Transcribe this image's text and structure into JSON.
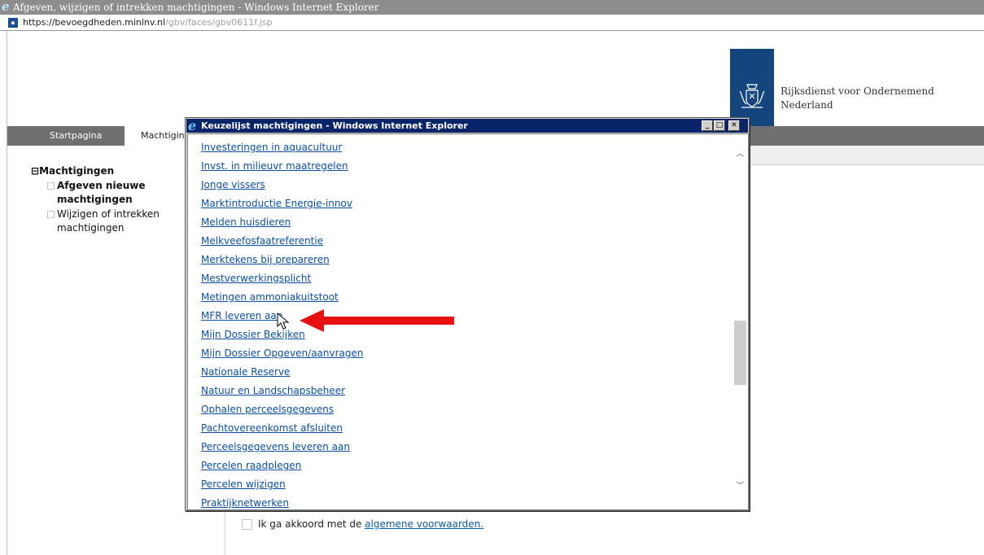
{
  "window": {
    "title": "Afgeven, wijzigen of intrekken machtigingen - Windows Internet Explorer",
    "icon": "ie-icon",
    "url_host": "https://bevoegdheden.minlnv.nl",
    "url_path": "/gbv/faces/gbv0611f.jsp"
  },
  "brand": {
    "line1": "Rijksdienst voor Ondernemend",
    "line2": "Nederland",
    "logo_color": "#15457d"
  },
  "nav": {
    "tabs": [
      "Startpagina",
      "Machtigin"
    ]
  },
  "sidebar": {
    "root": "Machtigingen",
    "root_toggle": "⊟",
    "items": [
      {
        "label": "Afgeven nieuwe machtigingen",
        "bold": true
      },
      {
        "label": "Wijzigen of intrekken machtigingen",
        "bold": false
      }
    ]
  },
  "agreement": {
    "text": "Ik ga akkoord met de ",
    "link": "algemene voorwaarden."
  },
  "popup": {
    "title": "Keuzelijst machtigingen - Windows Internet Explorer",
    "items": [
      "Investeringen in aquacultuur",
      "Invst. in milieuvr maatregelen",
      "Jonge vissers",
      "Marktintroductie Energie-innov",
      "Melden huisdieren",
      "Melkveefosfaatreferentie",
      "Merktekens bij prepareren",
      "Mestverwerkingsplicht",
      "Metingen ammoniakuitstoot",
      "MFR leveren aan",
      "Mijn Dossier Bekijken",
      "Mijn Dossier Opgeven/aanvragen",
      "Nationale Reserve",
      "Natuur en Landschapsbeheer",
      "Ophalen perceelsgegevens",
      "Pachtovereenkomst afsluiten",
      "Perceelsgegevens leveren aan",
      "Percelen raadplegen",
      "Percelen wijzigen",
      "Praktijknetwerken"
    ]
  },
  "colors": {
    "annotation_arrow": "#e81010",
    "link": "#0b4fa3",
    "popup_titlebar": "#0a246a"
  }
}
